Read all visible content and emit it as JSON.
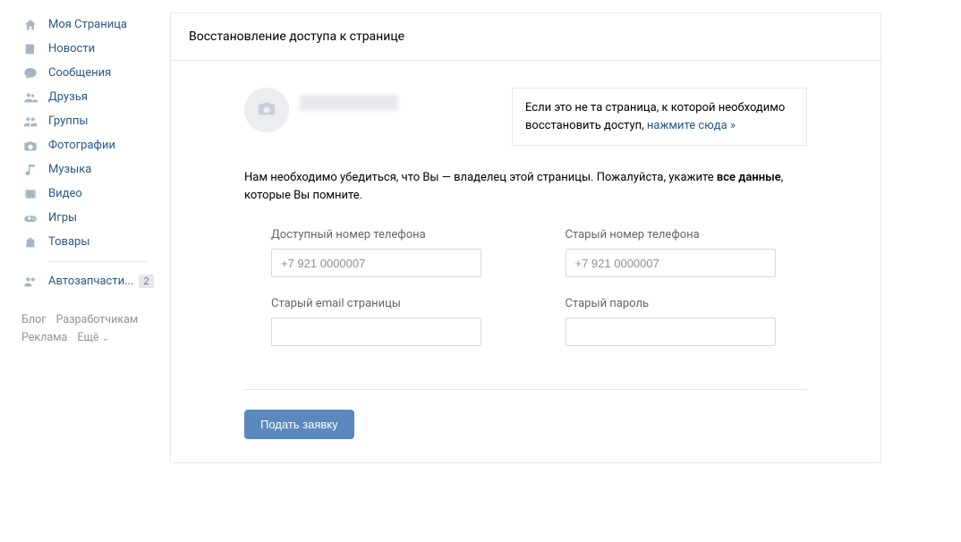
{
  "sidebar": {
    "items": [
      {
        "label": "Моя Страница",
        "icon": "home"
      },
      {
        "label": "Новости",
        "icon": "newspaper"
      },
      {
        "label": "Сообщения",
        "icon": "bubble"
      },
      {
        "label": "Друзья",
        "icon": "people"
      },
      {
        "label": "Группы",
        "icon": "group"
      },
      {
        "label": "Фотографии",
        "icon": "camera"
      },
      {
        "label": "Музыка",
        "icon": "music"
      },
      {
        "label": "Видео",
        "icon": "film"
      },
      {
        "label": "Игры",
        "icon": "gamepad"
      },
      {
        "label": "Товары",
        "icon": "bag"
      }
    ],
    "extra": {
      "label": "Автозапчасти...",
      "badge": "2",
      "icon": "people"
    }
  },
  "footer": {
    "blog": "Блог",
    "developers": "Разработчикам",
    "ads": "Реклама",
    "more": "Ещё"
  },
  "card": {
    "title": "Восстановление доступа к странице",
    "note_prefix": "Если это не та страница, к которой необходимо восстановить доступ, ",
    "note_link": "нажмите сюда »",
    "intro_part1": "Нам необходимо убедиться, что Вы — владелец этой страницы. Пожалуйста, укажите ",
    "intro_bold": "все данные",
    "intro_part2": ", которые Вы помните.",
    "fields": {
      "avail_phone_label": "Доступный номер телефона",
      "avail_phone_placeholder": "+7 921 0000007",
      "old_phone_label": "Старый номер телефона",
      "old_phone_placeholder": "+7 921 0000007",
      "old_email_label": "Старый email страницы",
      "old_password_label": "Старый пароль"
    },
    "submit": "Подать заявку"
  }
}
